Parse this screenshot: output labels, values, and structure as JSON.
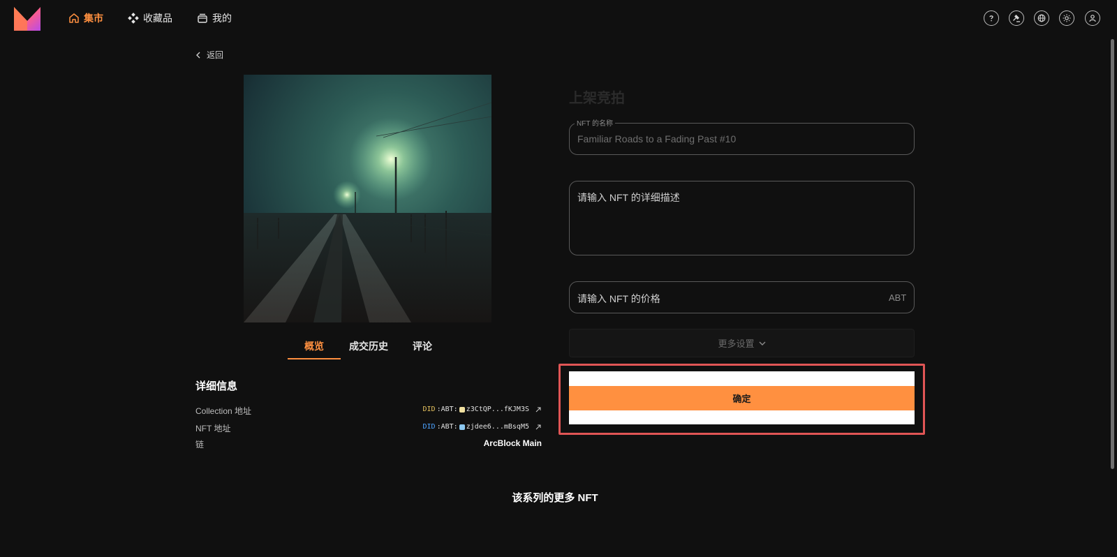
{
  "header": {
    "nav": [
      {
        "label": "集市",
        "icon": "home-icon",
        "active": true
      },
      {
        "label": "收藏品",
        "icon": "collection-icon",
        "active": false
      },
      {
        "label": "我的",
        "icon": "wallet-icon",
        "active": false
      }
    ],
    "right_icons": [
      "help-icon",
      "auction-icon",
      "globe-icon",
      "theme-icon",
      "user-icon"
    ]
  },
  "back": {
    "label": "返回"
  },
  "tabs": [
    {
      "label": "概览",
      "active": true
    },
    {
      "label": "成交历史",
      "active": false
    },
    {
      "label": "评论",
      "active": false
    }
  ],
  "details": {
    "title": "详细信息",
    "rows": [
      {
        "label": "Collection 地址",
        "prefix": "DID",
        "scheme": ":ABT:",
        "address": "z3CtQP...fKJM3S"
      },
      {
        "label": "NFT 地址",
        "prefix": "DID",
        "scheme": ":ABT:",
        "address": "zjdee6...mBsqM5"
      },
      {
        "label": "链",
        "value": "ArcBlock Main"
      }
    ]
  },
  "more_section": {
    "title": "该系列的更多 NFT"
  },
  "form": {
    "title": "上架竞拍",
    "name_label": "NFT 的名称",
    "name_value": "Familiar Roads to a Fading Past #10",
    "description_placeholder": "请输入 NFT 的详细描述",
    "price_placeholder": "请输入 NFT 的价格",
    "price_unit": "ABT",
    "more_settings": "更多设置",
    "confirm": "确定"
  },
  "colors": {
    "accent": "#ff9040",
    "background": "#101010",
    "highlight": "#e05555"
  }
}
